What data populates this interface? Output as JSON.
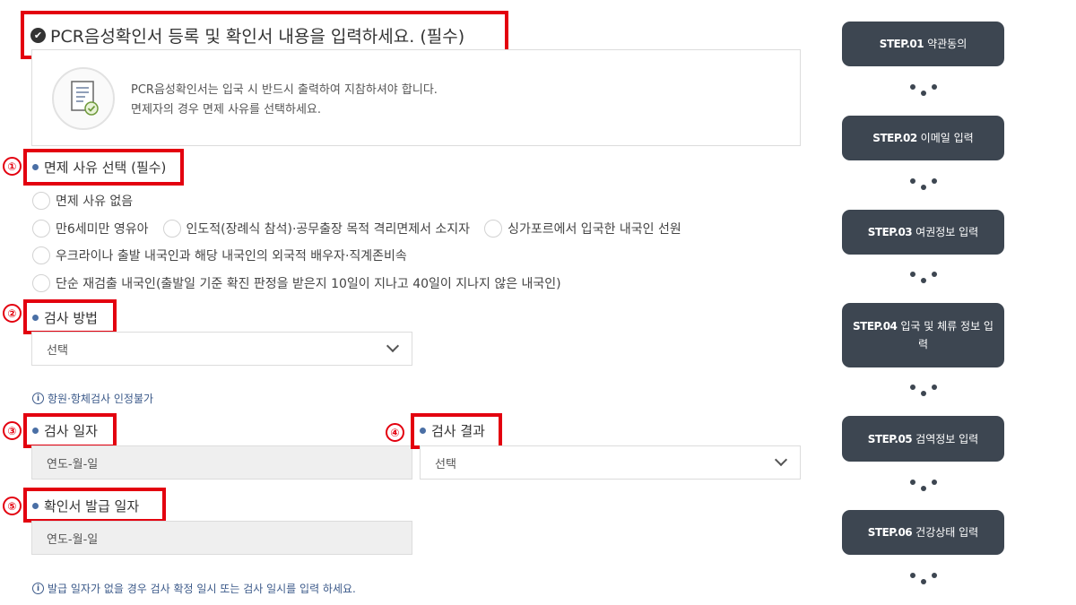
{
  "header": {
    "title": "PCR음성확인서 등록 및 확인서 내용을 입력하세요. (필수)"
  },
  "info": {
    "line1": "PCR음성확인서는 입국 시 반드시 출력하여 지참하셔야 합니다.",
    "line2": "면제자의 경우 면제 사유를 선택하세요."
  },
  "markers": [
    "①",
    "②",
    "③",
    "④",
    "⑤"
  ],
  "exemption": {
    "label": "면제 사유 선택 (필수)",
    "options": [
      "면제 사유 없음",
      "만6세미만 영유아",
      "인도적(장례식 참석)·공무출장 목적 격리면제서 소지자",
      "싱가포르에서 입국한 내국인 선원",
      "우크라이나 출발 내국인과 해당 내국인의 외국적 배우자·직계존비속",
      "단순 재검출 내국인(출발일 기준 확진 판정을 받은지 10일이 지나고 40일이 지나지 않은 내국인)"
    ]
  },
  "method": {
    "label": "검사 방법",
    "value": "선택",
    "note": "항원·항체검사 인정불가"
  },
  "test_date": {
    "label": "검사 일자",
    "placeholder": "연도-월-일"
  },
  "test_result": {
    "label": "검사 결과",
    "value": "선택"
  },
  "issue_date": {
    "label": "확인서 발급 일자",
    "placeholder": "연도-월-일",
    "note": "발급 일자가 없을 경우 검사 확정 일시 또는 검사 일시를 입력 하세요."
  },
  "steps": [
    {
      "num": "STEP.01",
      "label": "약관동의"
    },
    {
      "num": "STEP.02",
      "label": "이메일 입력"
    },
    {
      "num": "STEP.03",
      "label": "여권정보 입력"
    },
    {
      "num": "STEP.04",
      "label": "입국 및 체류 정보 입력"
    },
    {
      "num": "STEP.05",
      "label": "검역정보 입력"
    },
    {
      "num": "STEP.06",
      "label": "건강상태 입력"
    }
  ],
  "colors": {
    "annotation_red": "#e3000f",
    "step_bg": "#3d4651",
    "bullet": "#4a6fa5"
  }
}
